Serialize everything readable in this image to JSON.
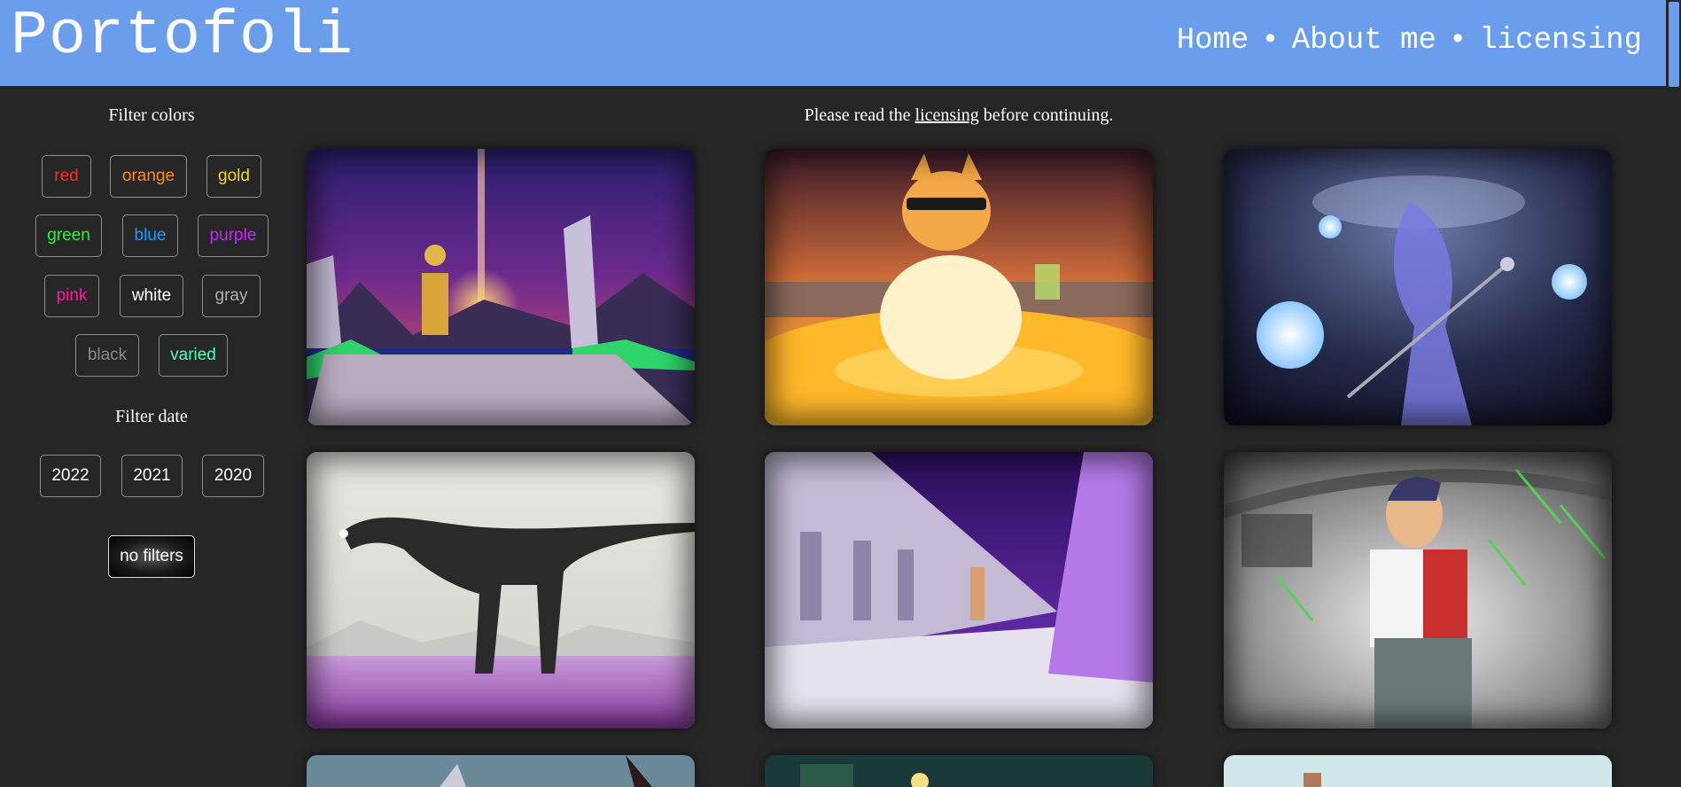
{
  "header": {
    "brand": "Portofoli",
    "nav": [
      {
        "label": "Home"
      },
      {
        "label": "About me"
      },
      {
        "label": "licensing"
      }
    ],
    "separator": "•",
    "background": "#6a9eed"
  },
  "sidebar": {
    "color_title": "Filter colors",
    "color_filters": [
      {
        "label": "red",
        "color": "#ff2a2a"
      },
      {
        "label": "orange",
        "color": "#ff8c1a"
      },
      {
        "label": "gold",
        "color": "#f5d21c"
      },
      {
        "label": "green",
        "color": "#1aff2a"
      },
      {
        "label": "blue",
        "color": "#1a9cff"
      },
      {
        "label": "purple",
        "color": "#c02aff"
      },
      {
        "label": "pink",
        "color": "#ff1aaa"
      },
      {
        "label": "white",
        "color": "#ffffff"
      },
      {
        "label": "gray",
        "color": "#b0b0b0"
      },
      {
        "label": "black",
        "color": "#8a8a8a"
      },
      {
        "label": "varied",
        "color": "#4dffc8"
      }
    ],
    "date_title": "Filter date",
    "date_filters": [
      {
        "label": "2022"
      },
      {
        "label": "2021"
      },
      {
        "label": "2020"
      }
    ],
    "clear_label": "no filters"
  },
  "notice": {
    "before": "Please read the ",
    "link": "licensing",
    "after": " before continuing."
  },
  "gallery": [
    {
      "icon": "temple-sunset-artwork"
    },
    {
      "icon": "cat-hot-tub-artwork"
    },
    {
      "icon": "cosmic-goddess-artwork"
    },
    {
      "icon": "dinosaur-lavender-field-artwork"
    },
    {
      "icon": "purple-hall-statues-artwork"
    },
    {
      "icon": "green-rain-hero-artwork"
    },
    {
      "icon": "partial-artwork-1"
    },
    {
      "icon": "partial-artwork-2"
    },
    {
      "icon": "partial-artwork-3"
    }
  ]
}
